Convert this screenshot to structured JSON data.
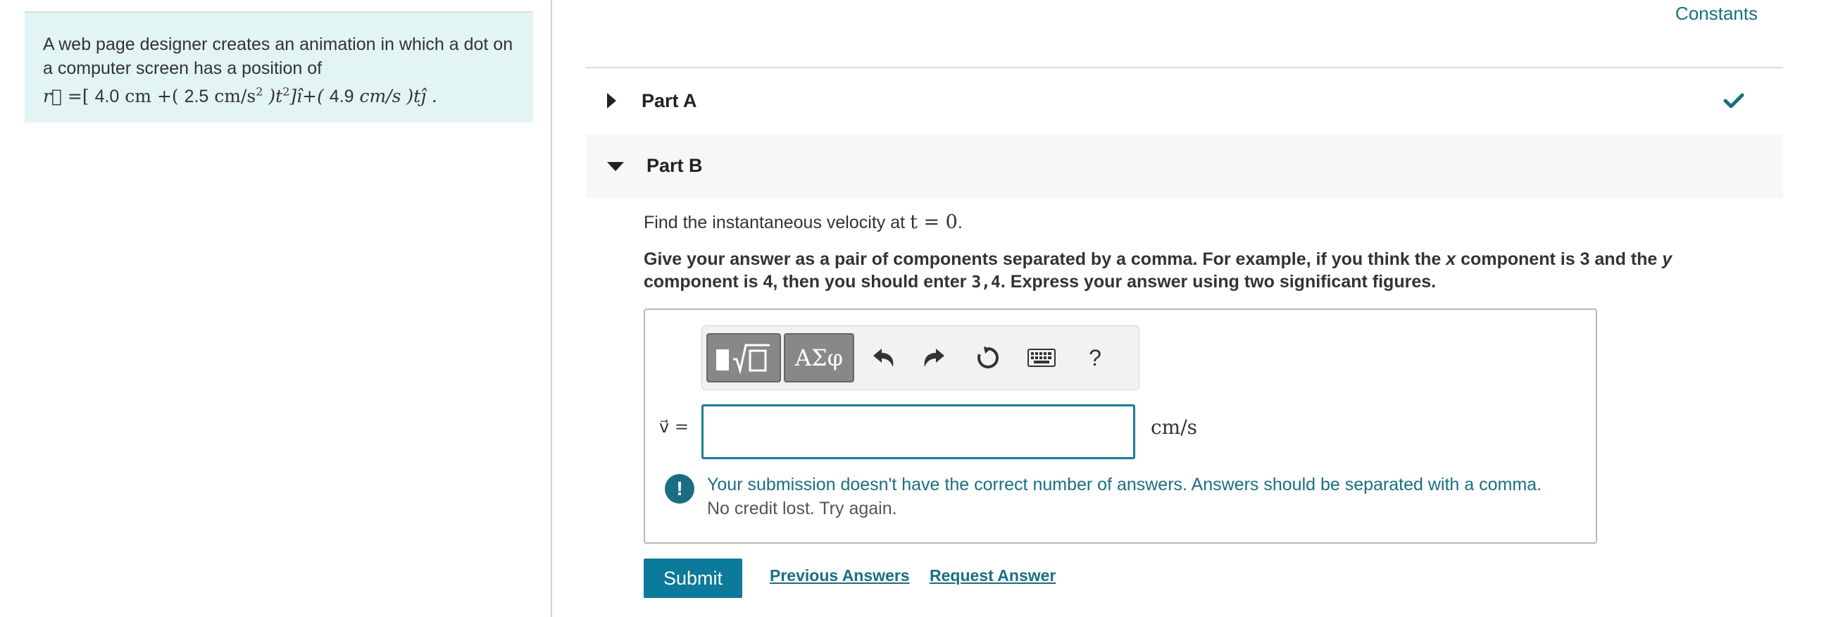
{
  "problem": {
    "text": "A web page designer creates an animation in which a dot on a computer screen has a position of",
    "eq_r": "r⃗",
    "eq_eq": " =[ ",
    "eq_a": "4.0",
    "eq_a_unit": " cm +( ",
    "eq_b": "2.5",
    "eq_b_unit": " cm/s",
    "eq_b_exp": "2",
    "eq_mid": " )t",
    "eq_t_exp": "2",
    "eq_i": "]î+( ",
    "eq_c": "4.9",
    "eq_c_unit": " cm/s )tĵ ."
  },
  "header": {
    "constants_link": "Constants"
  },
  "part_a": {
    "label": "Part A"
  },
  "part_b": {
    "label": "Part B",
    "question_prefix": "Find the instantaneous velocity at ",
    "question_math": "t = 0",
    "question_suffix": ".",
    "instr_1": "Give your answer as a pair of components separated by a comma. For example, if you think the ",
    "instr_x": "x",
    "instr_2": " component is 3 and the ",
    "instr_y": "y",
    "instr_3": " component is 4, then you should enter ",
    "instr_code": "3,4",
    "instr_4": ". Express your answer using two significant figures."
  },
  "toolbar": {
    "symbols_label": "ΑΣφ",
    "help_label": "?"
  },
  "answer": {
    "variable_label": "v⃗ =",
    "value": "",
    "units": "cm/s"
  },
  "feedback": {
    "icon": "!",
    "message": "Your submission doesn't have the correct number of answers. Answers should be separated with a comma.",
    "sub": "No credit lost. Try again."
  },
  "actions": {
    "submit_label": "Submit",
    "previous_answers_label": "Previous Answers",
    "request_answer_label": "Request Answer"
  },
  "colors": {
    "accent": "#1a6e84",
    "submit": "#0c7a9a",
    "problem_bg": "#e3f4f4"
  }
}
